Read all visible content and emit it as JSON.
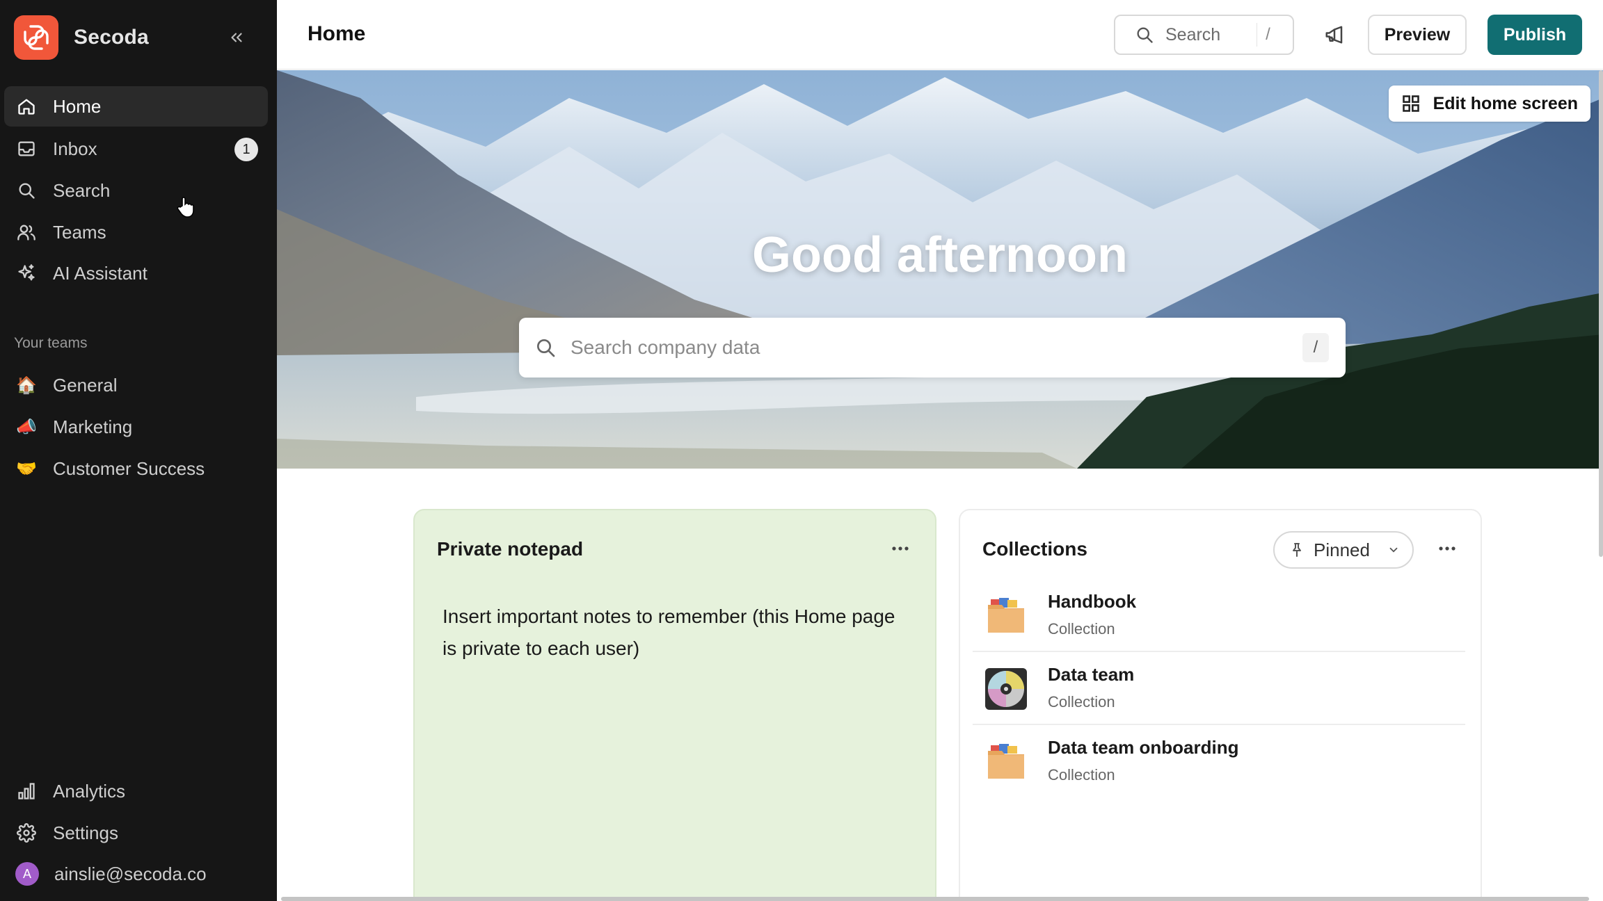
{
  "app": {
    "name": "Secoda",
    "brand_color": "#f1573a",
    "accent_color": "#116e72"
  },
  "sidebar": {
    "collapse_icon": "chevrons-left-icon",
    "nav": [
      {
        "label": "Home",
        "icon": "home-icon",
        "active": true
      },
      {
        "label": "Inbox",
        "icon": "inbox-icon",
        "badge": "1"
      },
      {
        "label": "Search",
        "icon": "search-icon"
      },
      {
        "label": "Teams",
        "icon": "users-icon"
      },
      {
        "label": "AI Assistant",
        "icon": "sparkles-icon"
      }
    ],
    "teams_label": "Your teams",
    "teams": [
      {
        "label": "General",
        "emoji": "🏠"
      },
      {
        "label": "Marketing",
        "emoji": "📣"
      },
      {
        "label": "Customer Success",
        "emoji": "🤝"
      }
    ],
    "bottom": [
      {
        "label": "Analytics",
        "icon": "bar-chart-icon"
      },
      {
        "label": "Settings",
        "icon": "gear-icon"
      }
    ],
    "user": {
      "initial": "A",
      "email": "ainslie@secoda.co"
    }
  },
  "topbar": {
    "title": "Home",
    "search_label": "Search",
    "search_shortcut": "/",
    "preview_label": "Preview",
    "publish_label": "Publish"
  },
  "hero": {
    "edit_label": "Edit home screen",
    "greeting": "Good afternoon",
    "search_placeholder": "Search company data",
    "search_shortcut": "/"
  },
  "notepad": {
    "title": "Private notepad",
    "text": "Insert important notes to remember (this Home page is private to each user)"
  },
  "collections": {
    "title": "Collections",
    "filter_label": "Pinned",
    "items": [
      {
        "name": "Handbook",
        "type": "Collection",
        "icon": "folder-icon"
      },
      {
        "name": "Data team",
        "type": "Collection",
        "icon": "disc-icon"
      },
      {
        "name": "Data team onboarding",
        "type": "Collection",
        "icon": "folder-icon"
      }
    ]
  }
}
